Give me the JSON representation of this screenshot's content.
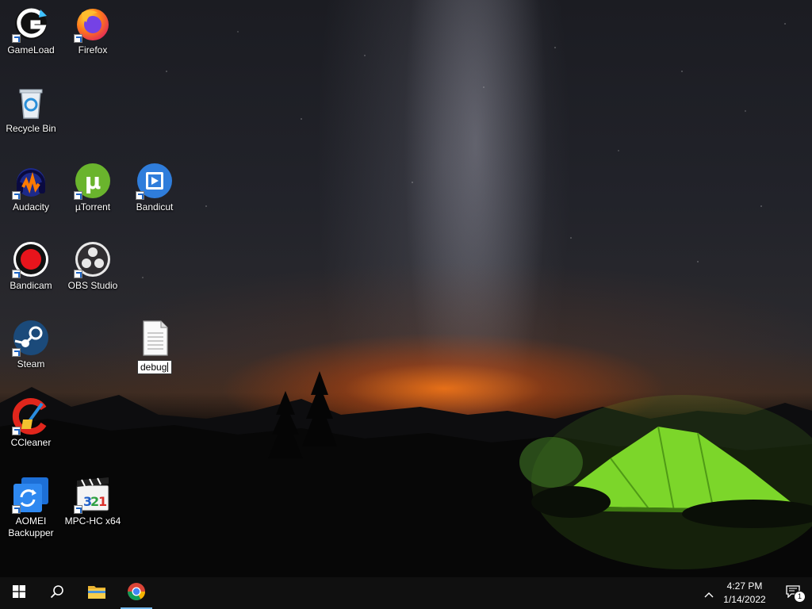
{
  "desktop": {
    "icons": [
      {
        "label": "GameLoad",
        "icon": "gameload-icon"
      },
      {
        "label": "Firefox",
        "icon": "firefox-icon"
      },
      {
        "label": "Recycle Bin",
        "icon": "recycle-bin-icon"
      },
      {
        "label": "Audacity",
        "icon": "audacity-icon"
      },
      {
        "label": "µTorrent",
        "icon": "utorrent-icon"
      },
      {
        "label": "Bandicut",
        "icon": "bandicut-icon"
      },
      {
        "label": "Bandicam",
        "icon": "bandicam-icon"
      },
      {
        "label": "OBS Studio",
        "icon": "obs-studio-icon"
      },
      {
        "label": "Steam",
        "icon": "steam-icon"
      },
      {
        "label": "CCleaner",
        "icon": "ccleaner-icon"
      },
      {
        "label": "AOMEI Backupper",
        "icon": "aomei-backupper-icon"
      },
      {
        "label": "MPC-HC x64",
        "icon": "mpc-hc-icon"
      }
    ],
    "renaming_file": {
      "value": "debug",
      "icon": "text-file-icon"
    }
  },
  "taskbar": {
    "buttons": [
      {
        "name": "start",
        "icon": "windows-logo-icon"
      },
      {
        "name": "search",
        "icon": "search-icon"
      },
      {
        "name": "file-explorer",
        "icon": "folder-icon"
      },
      {
        "name": "chrome",
        "icon": "chrome-icon",
        "active": true
      }
    ],
    "tray": {
      "show_hidden_icon": "chevron-up-icon",
      "time": "4:27 PM",
      "date": "1/14/2022",
      "notification_count": "1"
    }
  },
  "colors": {
    "taskbar_bg": "#101010",
    "accent": "#76b9ed",
    "tent_green": "#7cd62a"
  }
}
